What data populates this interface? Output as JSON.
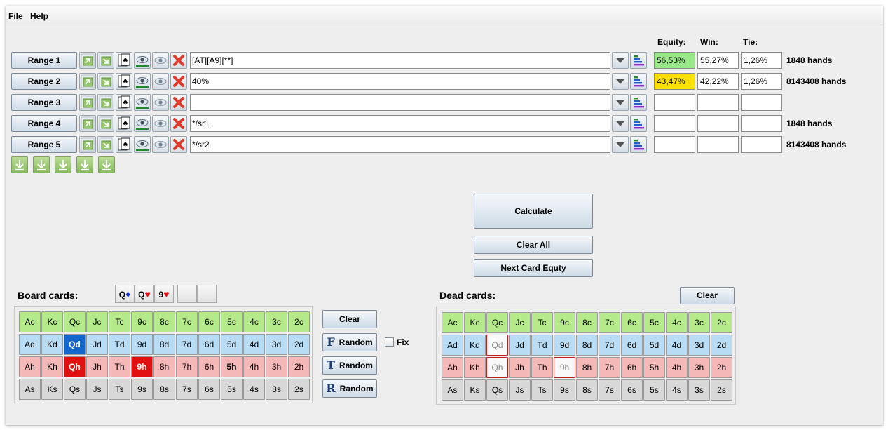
{
  "menu": {
    "items": [
      "File",
      "Help"
    ]
  },
  "headers": {
    "equity": "Equity:",
    "win": "Win:",
    "tie": "Tie:"
  },
  "ranges": [
    {
      "label": "Range 1",
      "value": "[AT][A9][**]",
      "equity": "56,53%",
      "win": "55,27%",
      "tie": "1,26%",
      "hands": "1848 hands",
      "equity_color": "#98e88a"
    },
    {
      "label": "Range 2",
      "value": "40%",
      "equity": "43,47%",
      "win": "42,22%",
      "tie": "1,26%",
      "hands": "8143408 hands",
      "equity_color": "#ffe000"
    },
    {
      "label": "Range 3",
      "value": "",
      "equity": "",
      "win": "",
      "tie": "",
      "hands": ""
    },
    {
      "label": "Range 4",
      "value": "*/sr1",
      "equity": "",
      "win": "",
      "tie": "",
      "hands": "1848 hands"
    },
    {
      "label": "Range 5",
      "value": "*/sr2",
      "equity": "",
      "win": "",
      "tie": "",
      "hands": "8143408 hands"
    }
  ],
  "range_icons": [
    "move-up-icon",
    "move-down-icon",
    "card-picker-icon",
    "show-icon",
    "hide-icon",
    "remove-icon"
  ],
  "actions": {
    "calculate": "Calculate",
    "clear_all": "Clear All",
    "next_card_equity": "Next Card Equty"
  },
  "board": {
    "title": "Board cards:",
    "selected": [
      {
        "rank": "Q",
        "suit": "♦",
        "suit_color": "#1030d0"
      },
      {
        "rank": "Q",
        "suit": "♥",
        "suit_color": "#e01010"
      },
      {
        "rank": "9",
        "suit": "♥",
        "suit_color": "#e01010"
      }
    ],
    "clear": "Clear",
    "random_flop": "Random",
    "random_turn": "Random",
    "random_river": "Random",
    "glyph_flop": "F",
    "glyph_turn": "T",
    "glyph_river": "R",
    "fix_label": "Fix",
    "fix_checked": false
  },
  "dead": {
    "title": "Dead cards:",
    "clear": "Clear"
  },
  "deck": {
    "ranks": [
      "A",
      "K",
      "Q",
      "J",
      "T",
      "9",
      "8",
      "7",
      "6",
      "5",
      "4",
      "3",
      "2"
    ],
    "suits": [
      "c",
      "d",
      "h",
      "s"
    ]
  },
  "board_state": {
    "Qd": "sel-d",
    "Qh": "sel-h",
    "9h": "sel-h",
    "5h": "bold5h"
  },
  "dead_state": {
    "Qd": "dead",
    "Qh": "dead",
    "9h": "dead"
  },
  "colors": {
    "clubs": "#b5ea8a",
    "diamonds": "#b8dcf4",
    "hearts": "#f4b8b8",
    "spades": "#d8d8d8",
    "selected_diamond": "#1266cc",
    "selected_heart": "#e01010"
  }
}
